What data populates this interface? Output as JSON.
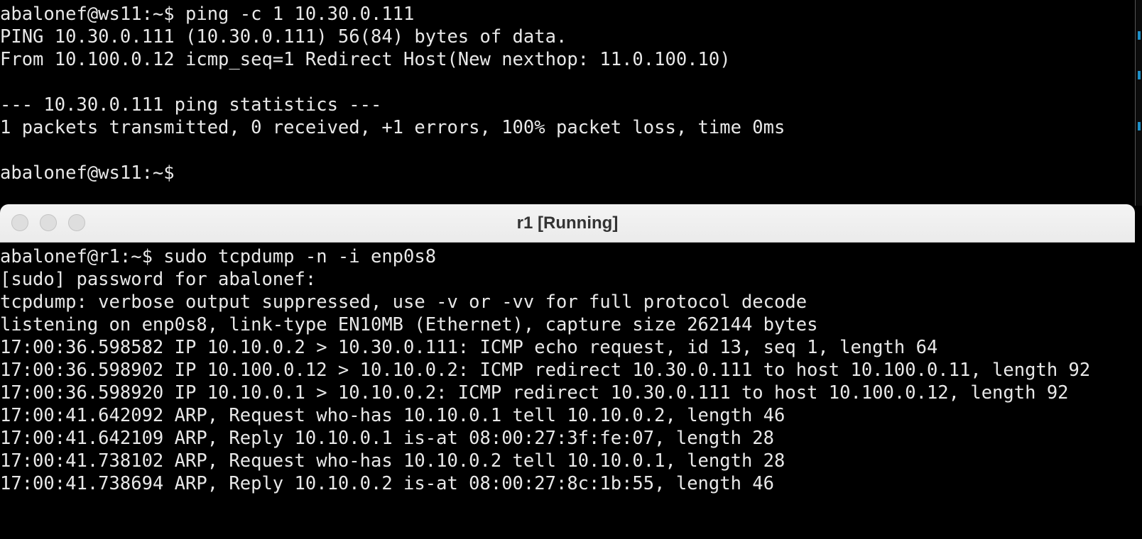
{
  "top_terminal": {
    "lines": [
      "abalonef@ws11:~$ ping -c 1 10.30.0.111",
      "PING 10.30.0.111 (10.30.0.111) 56(84) bytes of data.",
      "From 10.100.0.12 icmp_seq=1 Redirect Host(New nexthop: 11.0.100.10)",
      "",
      "--- 10.30.0.111 ping statistics ---",
      "1 packets transmitted, 0 received, +1 errors, 100% packet loss, time 0ms",
      "",
      "abalonef@ws11:~$"
    ]
  },
  "window": {
    "title": "r1 [Running]",
    "lines": [
      "abalonef@r1:~$ sudo tcpdump -n -i enp0s8",
      "[sudo] password for abalonef:",
      "tcpdump: verbose output suppressed, use -v or -vv for full protocol decode",
      "listening on enp0s8, link-type EN10MB (Ethernet), capture size 262144 bytes",
      "17:00:36.598582 IP 10.10.0.2 > 10.30.0.111: ICMP echo request, id 13, seq 1, length 64",
      "17:00:36.598902 IP 10.100.0.12 > 10.10.0.2: ICMP redirect 10.30.0.111 to host 10.100.0.11, length 92",
      "17:00:36.598920 IP 10.10.0.1 > 10.10.0.2: ICMP redirect 10.30.0.111 to host 10.100.0.12, length 92",
      "17:00:41.642092 ARP, Request who-has 10.10.0.1 tell 10.10.0.2, length 46",
      "17:00:41.642109 ARP, Reply 10.10.0.1 is-at 08:00:27:3f:fe:07, length 28",
      "17:00:41.738102 ARP, Request who-has 10.10.0.2 tell 10.10.0.1, length 28",
      "17:00:41.738694 ARP, Reply 10.10.0.2 is-at 08:00:27:8c:1b:55, length 46"
    ]
  },
  "colors": {
    "terminal_bg": "#000000",
    "terminal_fg": "#e8e8e8",
    "titlebar_bg": "#f0f0f0",
    "edge_accent": "#1e90c8"
  }
}
